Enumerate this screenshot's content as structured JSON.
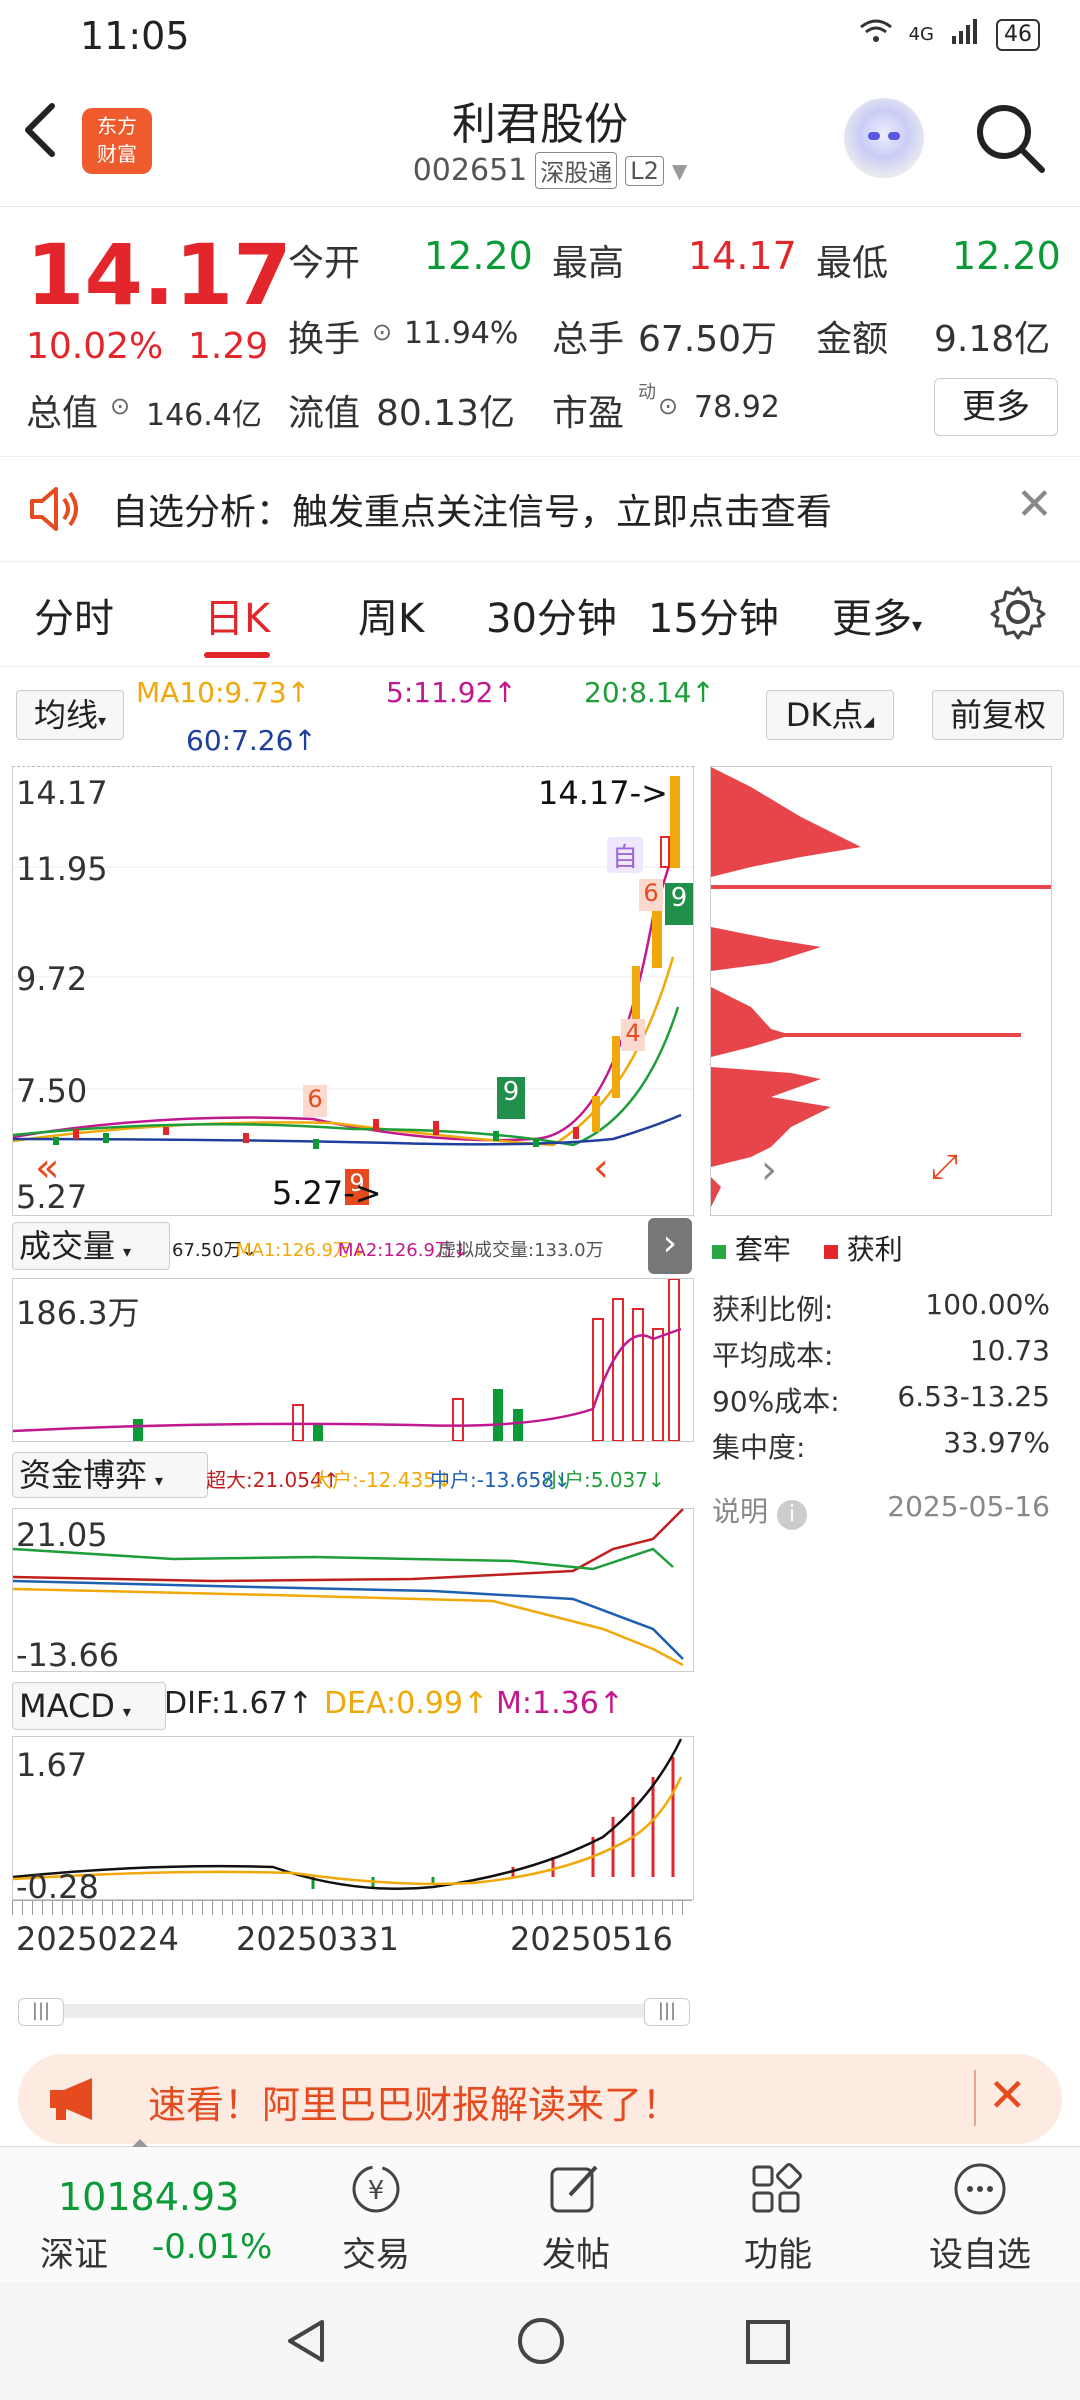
{
  "status_bar": {
    "time": "11:05",
    "network": "4G",
    "battery": "46"
  },
  "header": {
    "logo_line1": "东方",
    "logo_line2": "财富",
    "stock_name": "利君股份",
    "stock_code": "002651",
    "tag1": "深股通",
    "tag2": "L2"
  },
  "quote": {
    "price": "14.17",
    "change_pct": "10.02%",
    "change": "1.29",
    "open_label": "今开",
    "open": "12.20",
    "high_label": "最高",
    "high": "14.17",
    "low_label": "最低",
    "low": "12.20",
    "turnover_label": "换手",
    "turnover": "11.94%",
    "volume_label": "总手",
    "volume": "67.50万",
    "amount_label": "金额",
    "amount": "9.18亿",
    "mktcap_label": "总值",
    "mktcap": "146.4亿",
    "float_label": "流值",
    "float": "80.13亿",
    "pe_label": "市盈",
    "pe_sup": "动",
    "pe": "78.92",
    "more": "更多"
  },
  "alert": {
    "text": "自选分析：触发重点关注信号，立即点击查看"
  },
  "tabs": [
    "分时",
    "日K",
    "周K",
    "30分钟",
    "15分钟",
    "更多",
    "settings"
  ],
  "tabs_labels": {
    "t0": "分时",
    "t1": "日K",
    "t2": "周K",
    "t3": "30分钟",
    "t4": "15分钟",
    "t5": "更多"
  },
  "ma_bar": {
    "select": "均线",
    "ma10": "MA10:9.73↑",
    "ma5": "5:11.92↑",
    "ma20": "20:8.14↑",
    "ma60": "60:7.26↑",
    "dk": "DK点",
    "fq": "前复权"
  },
  "kline": {
    "y_labels": [
      "14.17",
      "11.95",
      "9.72",
      "7.50",
      "5.27"
    ],
    "max_marker": "14.17->",
    "min_marker": "5.27->",
    "self_tag": "自"
  },
  "volume": {
    "select": "成交量",
    "indicators": {
      "v": "67.50万↓",
      "ma1": "MA1:126.9万↓",
      "ma2": "MA2:126.9万↓",
      "virt": "虚拟成交量:133.0万"
    },
    "y_top": "186.3万"
  },
  "capital": {
    "select": "资金博弈",
    "indicators": {
      "super": "超大:21.054↑",
      "big": "大户:-12.435↓",
      "mid": "中户:-13.658↓",
      "small": "小户:5.037↓"
    },
    "y_top": "21.05",
    "y_bottom": "-13.66"
  },
  "macd": {
    "select": "MACD",
    "dif": "DIF:1.67↑",
    "dea": "DEA:0.99↑",
    "m": "M:1.36↑",
    "y_top": "1.67",
    "y_bottom": "-0.28"
  },
  "dates": [
    "20250224",
    "20250331",
    "20250516"
  ],
  "chip": {
    "legend_trap": "套牢",
    "legend_profit": "获利",
    "rows": [
      {
        "label": "获利比例:",
        "value": "100.00%"
      },
      {
        "label": "平均成本:",
        "value": "10.73"
      },
      {
        "label": "90%成本:",
        "value": "6.53-13.25"
      },
      {
        "label": "集中度:",
        "value": "33.97%"
      }
    ],
    "note": "说明",
    "date": "2025-05-16"
  },
  "promo": {
    "text": "速看！阿里巴巴财报解读来了！"
  },
  "bottom_nav": {
    "index_value": "10184.93",
    "index_name": "深证",
    "index_change": "-0.01%",
    "trade": "交易",
    "post": "发帖",
    "function": "功能",
    "watch": "设自选"
  },
  "colors": {
    "up": "#e2262b",
    "down": "#0a9a36",
    "accent": "#e2262b"
  }
}
